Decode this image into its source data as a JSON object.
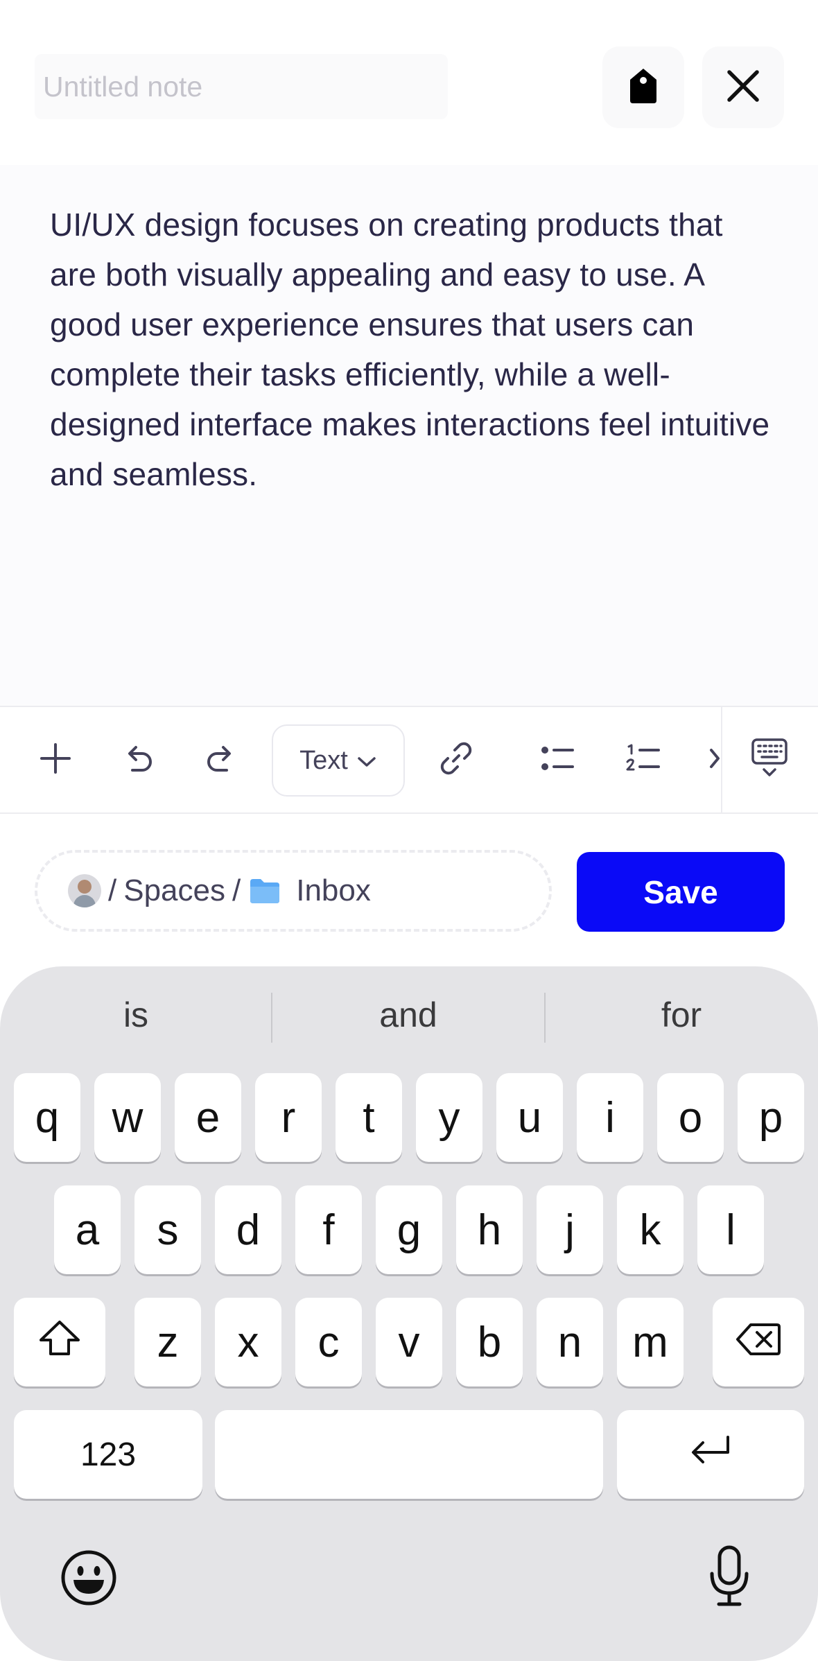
{
  "header": {
    "title_placeholder": "Untitled note",
    "title_value": ""
  },
  "editor": {
    "body_text": "UI/UX design focuses on creating products that are both visually appealing and easy to use. A good user experience ensures that users can complete their tasks efficiently, while a well-designed interface makes interactions feel intuitive and seamless."
  },
  "toolbar": {
    "text_style_label": "Text",
    "icons": [
      "plus-icon",
      "undo-icon",
      "redo-icon",
      "link-icon",
      "bullet-list-icon",
      "numbered-list-icon",
      "more-chevron-icon",
      "keyboard-hide-icon"
    ]
  },
  "location": {
    "separator1": "/",
    "space_label": "Spaces",
    "separator2": "/",
    "folder_label": "Inbox"
  },
  "actions": {
    "save_label": "Save"
  },
  "colors": {
    "accent": "#0a0af7",
    "text": "#2a2747",
    "folder": "#5aa9f5"
  },
  "keyboard": {
    "suggestions": [
      "is",
      "and",
      "for"
    ],
    "row1": [
      "q",
      "w",
      "e",
      "r",
      "t",
      "y",
      "u",
      "i",
      "o",
      "p"
    ],
    "row2": [
      "a",
      "s",
      "d",
      "f",
      "g",
      "h",
      "j",
      "k",
      "l"
    ],
    "row3": [
      "z",
      "x",
      "c",
      "v",
      "b",
      "n",
      "m"
    ],
    "numbers_label": "123"
  }
}
